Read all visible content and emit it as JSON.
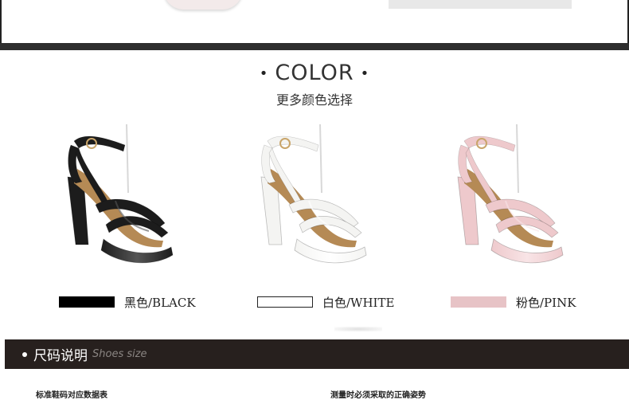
{
  "color_section": {
    "title": "COLOR",
    "dot": "•",
    "subtitle": "更多颜色选择"
  },
  "colors": [
    {
      "label": "黑色/BLACK",
      "swatch": "#000000",
      "shoe_color": "#1c1c1c",
      "highlight": "#555555"
    },
    {
      "label": "白色/WHITE",
      "swatch": "#ffffff",
      "shoe_color": "#f4f4f2",
      "highlight": "#ffffff"
    },
    {
      "label": "粉色/PINK",
      "swatch": "#e7c3c6",
      "shoe_color": "#eec9cc",
      "highlight": "#f8e4e6"
    }
  ],
  "size_section": {
    "title_cn": "尺码说明",
    "title_en": "Shoes size"
  },
  "bottom": {
    "left_caption": "标准鞋码对应数据表",
    "right_caption": "测量时必须采取的正确姿势"
  }
}
